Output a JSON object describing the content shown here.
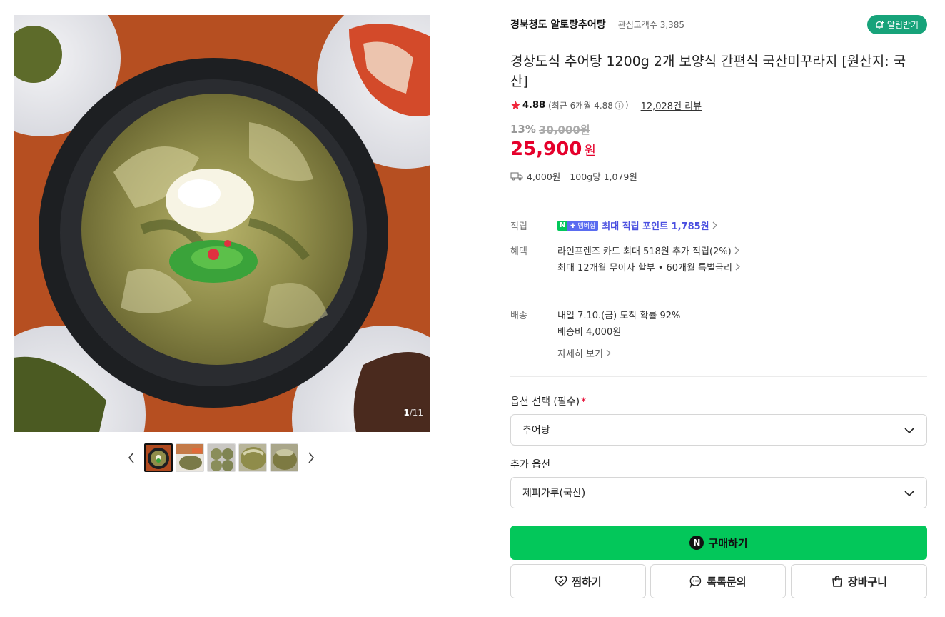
{
  "gallery": {
    "counter_current": "1",
    "counter_total": "/11",
    "thumbnails": [
      "thumb-1",
      "thumb-2",
      "thumb-3",
      "thumb-4",
      "thumb-5"
    ]
  },
  "store": {
    "name": "경북청도 알토랑추어탕",
    "interest_label": "관심고객수 3,385",
    "alarm_label": "알림받기"
  },
  "product": {
    "title": "경상도식 추어탕 1200g 2개 보양식 간편식 국산미꾸라지 [원산지: 국산]",
    "rating": "4.88",
    "rating_recent": "(최근 6개월 4.88",
    "rating_recent_close": ")",
    "reviews": "12,028건 리뷰",
    "discount_rate": "13%",
    "original_price": "30,000원",
    "price": "25,900",
    "currency": "원",
    "shipping_fee": "4,000원",
    "unit_price": "100g당 1,079원"
  },
  "benefits": {
    "point_label": "적립",
    "point_badge_n": "N",
    "point_badge_plus": "✚ 멤버십",
    "point_text": "최대 적립 포인트 1,785원",
    "benefit_label": "혜택",
    "card_text": "라인프렌즈 카드 최대 518원 추가 적립(2%)",
    "installment_text": "최대 12개월 무이자 할부 • 60개월 특별금리"
  },
  "delivery": {
    "label": "배송",
    "arrival": "내일 7.10.(금) 도착 확률 92%",
    "fee": "배송비 4,000원",
    "detail_link": "자세히 보기"
  },
  "options": {
    "select_label": "옵션 선택 (필수)",
    "required_mark": "*",
    "select_value": "추어탕",
    "extra_label": "추가 옵션",
    "extra_value": "제피가루(국산)"
  },
  "actions": {
    "buy_icon": "N",
    "buy": "구매하기",
    "wish": "찜하기",
    "talk": "톡톡문의",
    "cart": "장바구니"
  },
  "colors": {
    "accent_green": "#03c75a",
    "price_red": "#e5002b",
    "alarm_teal": "#17a37a"
  }
}
